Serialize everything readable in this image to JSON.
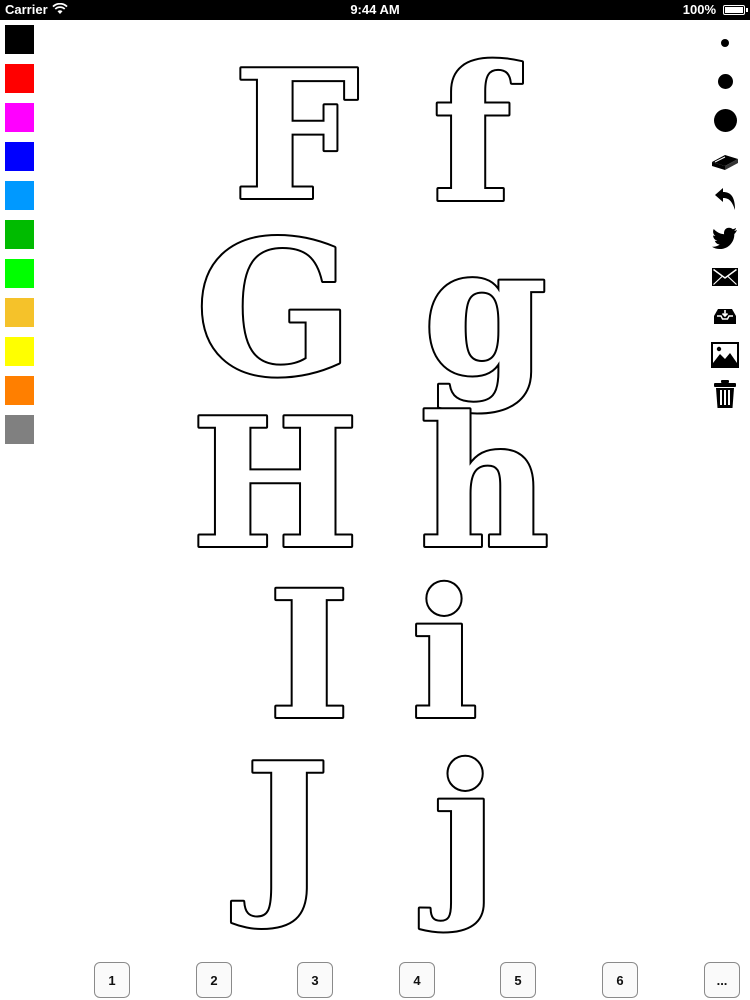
{
  "status_bar": {
    "carrier": "Carrier",
    "time": "9:44 AM",
    "battery": "100%",
    "battery_level": 1.0
  },
  "palette": {
    "colors": [
      "#000000",
      "#ff0000",
      "#ff00ff",
      "#0000ff",
      "#0099ff",
      "#00bb00",
      "#00ff00",
      "#f5c22a",
      "#ffff00",
      "#ff7f00",
      "#808080"
    ]
  },
  "tools": {
    "items": [
      {
        "icon": "brush-size-small-icon"
      },
      {
        "icon": "brush-size-medium-icon"
      },
      {
        "icon": "brush-size-large-icon"
      },
      {
        "icon": "eraser-icon"
      },
      {
        "icon": "undo-icon"
      },
      {
        "icon": "twitter-icon"
      },
      {
        "icon": "mail-icon"
      },
      {
        "icon": "save-tray-icon"
      },
      {
        "icon": "photo-icon"
      },
      {
        "icon": "trash-icon"
      }
    ]
  },
  "letters": {
    "row1": {
      "upper": "F",
      "lower": "f"
    },
    "row2": {
      "upper": "G",
      "lower": "g"
    },
    "row3": {
      "upper": "H",
      "lower": "h"
    },
    "row4": {
      "upper": "I",
      "lower": "i"
    },
    "row5": {
      "upper": "J",
      "lower": "j"
    }
  },
  "pages": {
    "labels": [
      "1",
      "2",
      "3",
      "4",
      "5",
      "6",
      "..."
    ]
  }
}
